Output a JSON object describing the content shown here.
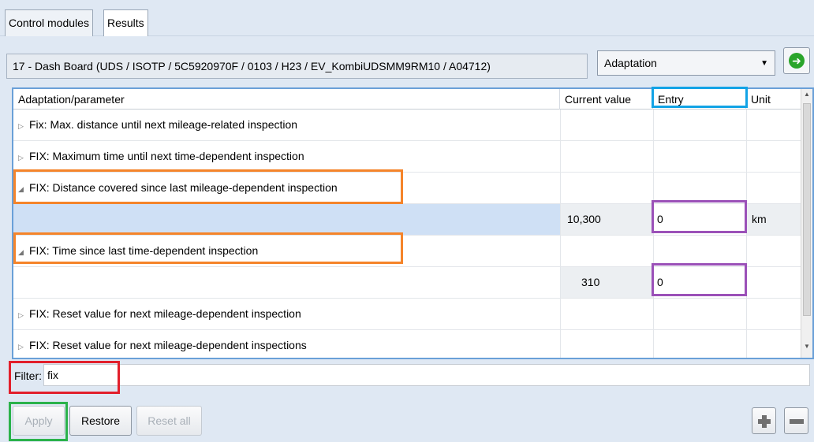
{
  "tabs": [
    {
      "label": "Control modules"
    },
    {
      "label": "Results"
    }
  ],
  "module": {
    "description": "17 - Dash Board  (UDS / ISOTP / 5C5920970F  / 0103 / H23 / EV_KombiUDSMM9RM10 / A04712)"
  },
  "mode_select": {
    "value": "Adaptation",
    "arrow": "▼"
  },
  "go_button": {
    "icon": "go-arrow-icon",
    "glyph": "➜"
  },
  "table": {
    "headers": {
      "parameter": "Adaptation/parameter",
      "current_value": "Current value",
      "entry": "Entry",
      "unit": "Unit"
    },
    "rows": [
      {
        "text": "Fix: Max. distance until next mileage-related inspection",
        "expander": "▷"
      },
      {
        "text": "FIX: Maximum time until next time-dependent inspection",
        "expander": "▷"
      },
      {
        "text": "FIX: Distance covered since last mileage-dependent inspection",
        "expander": "◢"
      },
      {
        "value": "10,300",
        "entry": "0",
        "unit": "km"
      },
      {
        "text": "FIX: Time since last time-dependent inspection",
        "expander": "◢"
      },
      {
        "value": "310",
        "entry": "0"
      },
      {
        "text": "FIX: Reset value for next mileage-dependent inspection",
        "expander": "▷"
      },
      {
        "text": "FIX: Reset value for next mileage-dependent inspections",
        "expander": "▷"
      }
    ]
  },
  "scrollbar": {
    "up": "▲",
    "down": "▼"
  },
  "filter": {
    "label": "Filter:",
    "value": "fix"
  },
  "buttons": {
    "apply": "Apply",
    "restore": "Restore",
    "reset_all": "Reset all"
  },
  "colors": {
    "highlight_orange": "#f5842a",
    "highlight_purple": "#9b51b8",
    "highlight_blue": "#12a3e6",
    "highlight_red": "#e21f2b",
    "highlight_green": "#2ab24a"
  }
}
